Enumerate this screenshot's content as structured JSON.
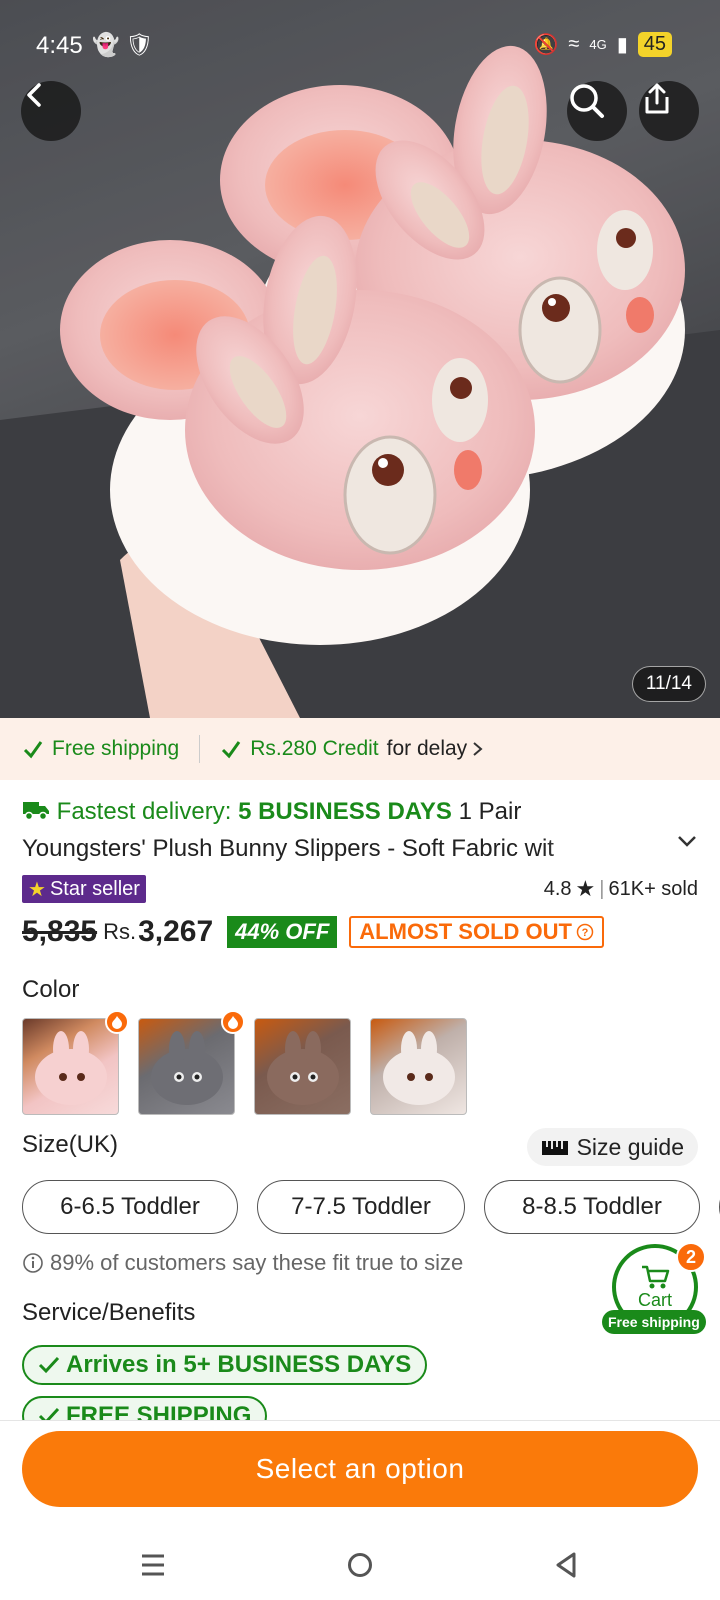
{
  "status_bar": {
    "time": "4:45",
    "network": "4G",
    "battery": "45"
  },
  "image": {
    "counter": "11/14"
  },
  "shipping_strip": {
    "free_shipping": "Free shipping",
    "credit": "Rs.280 Credit",
    "credit_suffix": "for delay"
  },
  "product": {
    "fastest_prefix": "Fastest delivery:",
    "fastest_days": "5 BUSINESS DAYS",
    "title_start": "1 Pair",
    "title_line2": "Youngsters' Plush Bunny Slippers - Soft Fabric wit",
    "badge": "Star seller",
    "rating": "4.8",
    "sold": "61K+ sold",
    "old_price": "5,835",
    "currency": "Rs.",
    "price": "3,267",
    "discount": "44% OFF",
    "stock": "ALMOST SOLD OUT"
  },
  "color": {
    "label": "Color",
    "swatches": [
      {
        "name": "pink",
        "hex": "#f2c4c4",
        "hot": true
      },
      {
        "name": "grey",
        "hex": "#7a7a80",
        "hot": true
      },
      {
        "name": "brown",
        "hex": "#8b6e62",
        "hot": false
      },
      {
        "name": "white",
        "hex": "#efe6e2",
        "hot": false
      }
    ]
  },
  "size": {
    "label": "Size(UK)",
    "guide": "Size guide",
    "options": [
      "6-6.5 Toddler",
      "7-7.5 Toddler",
      "8-8.5 Toddler"
    ],
    "fit_note": "89% of customers say these fit true to size"
  },
  "service": {
    "label": "Service/Benefits",
    "benefits": [
      "Arrives in 5+ BUSINESS DAYS",
      "FREE SHIPPING"
    ]
  },
  "cart": {
    "label": "Cart",
    "count": "2",
    "tag": "Free shipping"
  },
  "cta": {
    "label": "Select an option"
  },
  "colors": {
    "accent": "#fa7a0a",
    "green": "#1a8a1a",
    "star_badge": "#5d2a8c"
  }
}
